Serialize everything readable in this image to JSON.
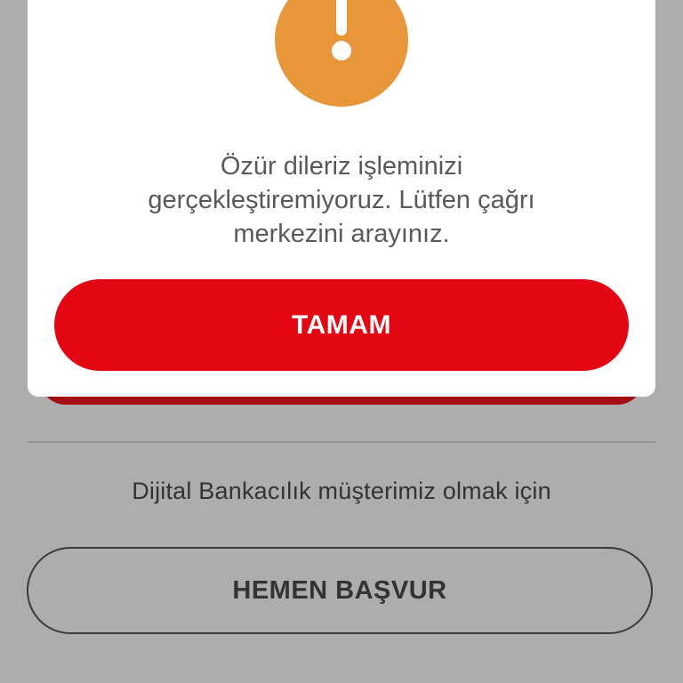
{
  "dialog": {
    "icon": "warning-exclamation-icon",
    "message_lines": [
      "Özür dileriz işleminizi",
      "gerçekleştiremiyoruz. Lütfen çağrı",
      "merkezini arayınız."
    ],
    "ok_label": "TAMAM"
  },
  "background": {
    "prompt": "Dijital Bankacılık müşterimiz olmak için",
    "apply_label": "HEMEN BAŞVUR"
  },
  "colors": {
    "overlay": "#adadad",
    "accent_red": "#e30613",
    "warning_orange": "#e8963a"
  }
}
